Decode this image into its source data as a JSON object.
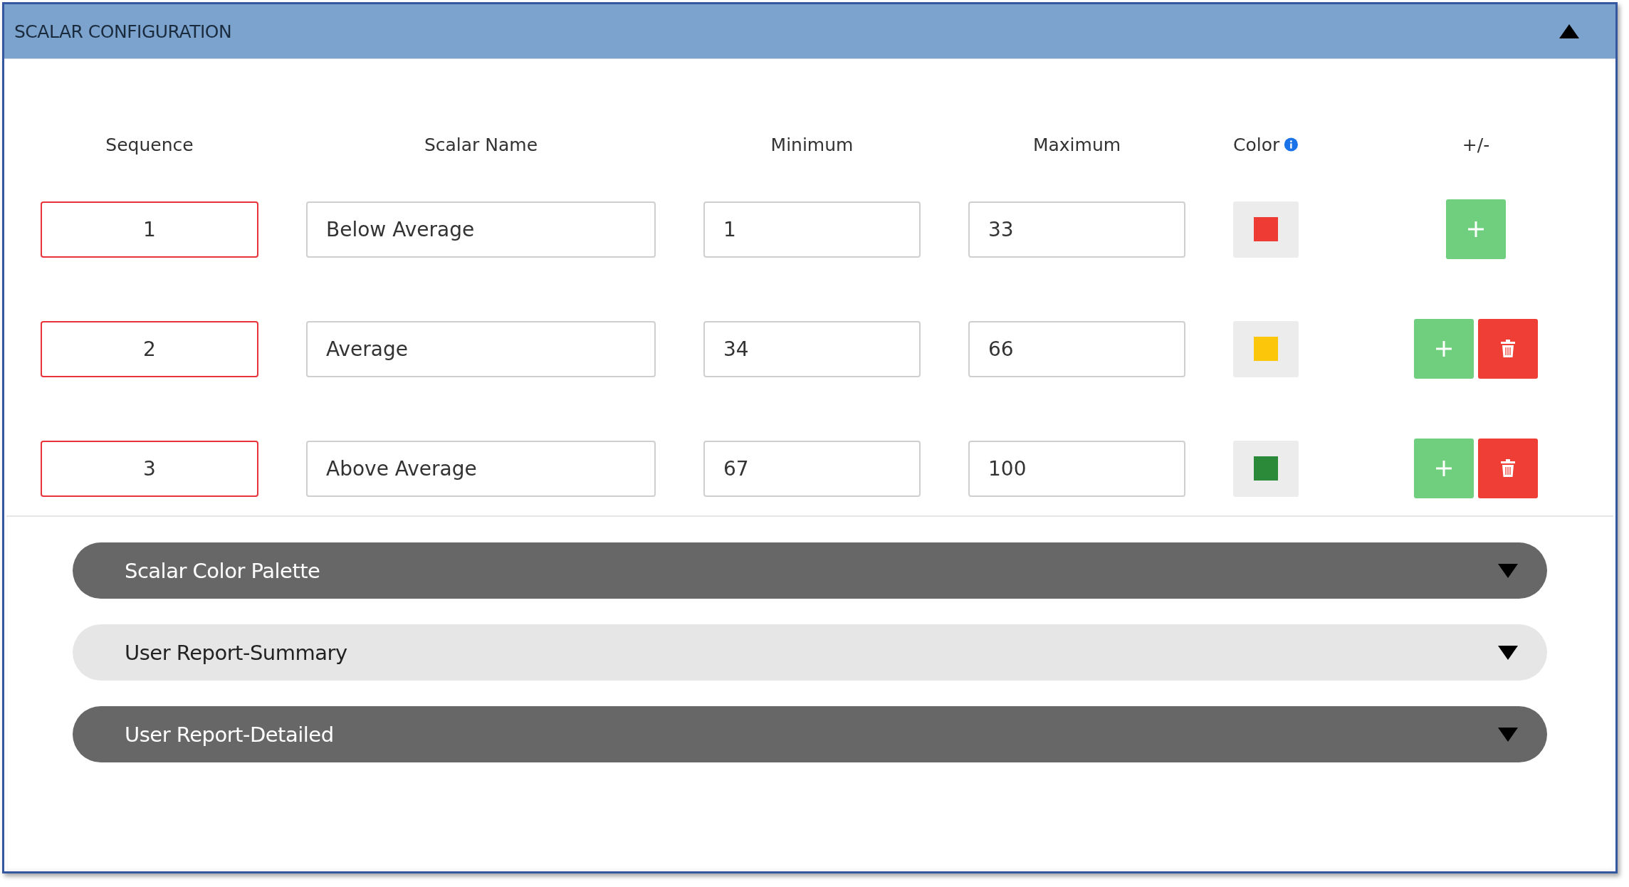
{
  "panel": {
    "title": "SCALAR CONFIGURATION",
    "expanded": true
  },
  "columns": [
    "Sequence",
    "Scalar Name",
    "Minimum",
    "Maximum",
    "Color",
    "+/-"
  ],
  "rows": [
    {
      "sequence": "1",
      "name": "Below Average",
      "minimum": "1",
      "maximum": "33",
      "color": "#ee3b34",
      "actions": [
        {
          "kind": "add"
        }
      ]
    },
    {
      "sequence": "2",
      "name": "Average",
      "minimum": "34",
      "maximum": "66",
      "color": "#fcc60a",
      "actions": [
        {
          "kind": "add"
        },
        {
          "kind": "delete"
        }
      ]
    },
    {
      "sequence": "3",
      "name": "Above Average",
      "minimum": "67",
      "maximum": "100",
      "color": "#2a8a3a",
      "actions": [
        {
          "kind": "add"
        },
        {
          "kind": "delete"
        }
      ]
    }
  ],
  "sections": [
    {
      "title": "Scalar Color Palette",
      "expanded": false,
      "selected": false
    },
    {
      "title": "User Report-Summary",
      "expanded": false,
      "selected": true
    },
    {
      "title": "User Report-Detailed",
      "expanded": false,
      "selected": false
    }
  ]
}
